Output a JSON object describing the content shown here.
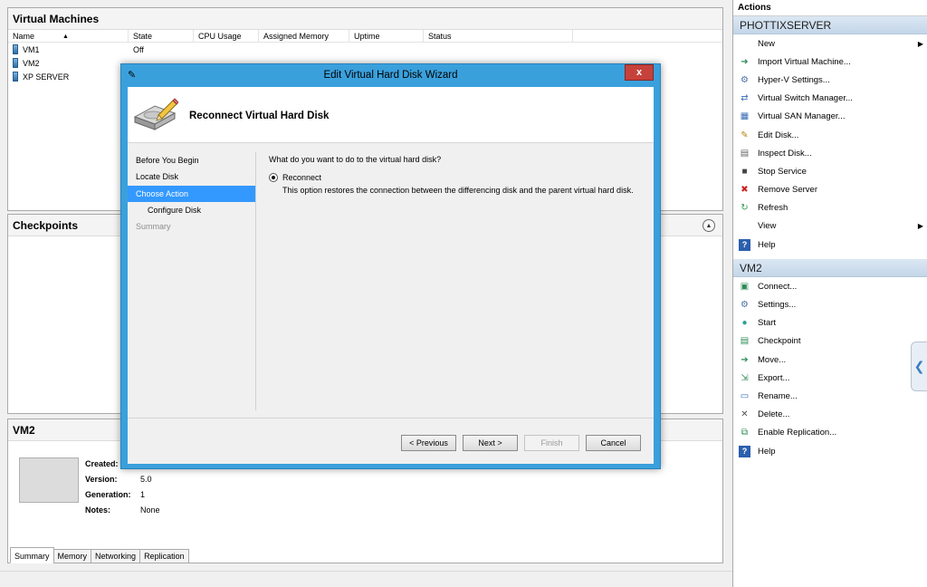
{
  "vm_panel": {
    "title": "Virtual Machines",
    "columns": [
      "Name",
      "State",
      "CPU Usage",
      "Assigned Memory",
      "Uptime",
      "Status"
    ],
    "rows": [
      {
        "name": "VM1",
        "state": "Off"
      },
      {
        "name": "VM2",
        "state": ""
      },
      {
        "name": "XP SERVER",
        "state": ""
      }
    ]
  },
  "checkpoints": {
    "title": "Checkpoints"
  },
  "details": {
    "title": "VM2",
    "props": [
      {
        "key": "Created:",
        "value": ""
      },
      {
        "key": "Version:",
        "value": "5.0"
      },
      {
        "key": "Generation:",
        "value": "1"
      },
      {
        "key": "Notes:",
        "value": "None"
      }
    ],
    "tabs": [
      "Summary",
      "Memory",
      "Networking",
      "Replication"
    ]
  },
  "actions": {
    "title": "Actions",
    "server": {
      "name": "PHOTTIXSERVER",
      "items": [
        {
          "label": "New",
          "icon": "none",
          "submenu": true
        },
        {
          "label": "Import Virtual Machine...",
          "icon": "import-icon"
        },
        {
          "label": "Hyper-V Settings...",
          "icon": "settings-icon"
        },
        {
          "label": "Virtual Switch Manager...",
          "icon": "switch-icon"
        },
        {
          "label": "Virtual SAN Manager...",
          "icon": "san-icon"
        },
        {
          "label": "Edit Disk...",
          "icon": "edit-disk-icon"
        },
        {
          "label": "Inspect Disk...",
          "icon": "inspect-disk-icon"
        },
        {
          "label": "Stop Service",
          "icon": "stop-icon"
        },
        {
          "label": "Remove Server",
          "icon": "remove-icon"
        },
        {
          "label": "Refresh",
          "icon": "refresh-icon"
        },
        {
          "label": "View",
          "icon": "none",
          "submenu": true
        },
        {
          "label": "Help",
          "icon": "help-icon"
        }
      ]
    },
    "vm": {
      "name": "VM2",
      "items": [
        {
          "label": "Connect...",
          "icon": "connect-icon"
        },
        {
          "label": "Settings...",
          "icon": "settings-icon"
        },
        {
          "label": "Start",
          "icon": "start-icon"
        },
        {
          "label": "Checkpoint",
          "icon": "checkpoint-icon"
        },
        {
          "label": "Move...",
          "icon": "move-icon"
        },
        {
          "label": "Export...",
          "icon": "export-icon"
        },
        {
          "label": "Rename...",
          "icon": "rename-icon"
        },
        {
          "label": "Delete...",
          "icon": "delete-icon"
        },
        {
          "label": "Enable Replication...",
          "icon": "replication-icon"
        },
        {
          "label": "Help",
          "icon": "help-icon"
        }
      ]
    }
  },
  "wizard": {
    "title": "Edit Virtual Hard Disk Wizard",
    "close_label": "x",
    "heading": "Reconnect Virtual Hard Disk",
    "steps": [
      {
        "label": "Before You Begin",
        "state": "normal",
        "indent": false
      },
      {
        "label": "Locate Disk",
        "state": "normal",
        "indent": false
      },
      {
        "label": "Choose Action",
        "state": "active",
        "indent": false
      },
      {
        "label": "Configure Disk",
        "state": "normal",
        "indent": true
      },
      {
        "label": "Summary",
        "state": "disabled",
        "indent": false
      }
    ],
    "question": "What do you want to do to the virtual hard disk?",
    "option_label": "Reconnect",
    "option_desc": "This option restores the connection between the differencing disk and the parent virtual hard disk.",
    "buttons": {
      "previous": "< Previous",
      "next": "Next >",
      "finish": "Finish",
      "cancel": "Cancel"
    },
    "colors": {
      "frame": "#3aa0dc",
      "active_step": "#3399ff",
      "close": "#c7413b"
    }
  }
}
